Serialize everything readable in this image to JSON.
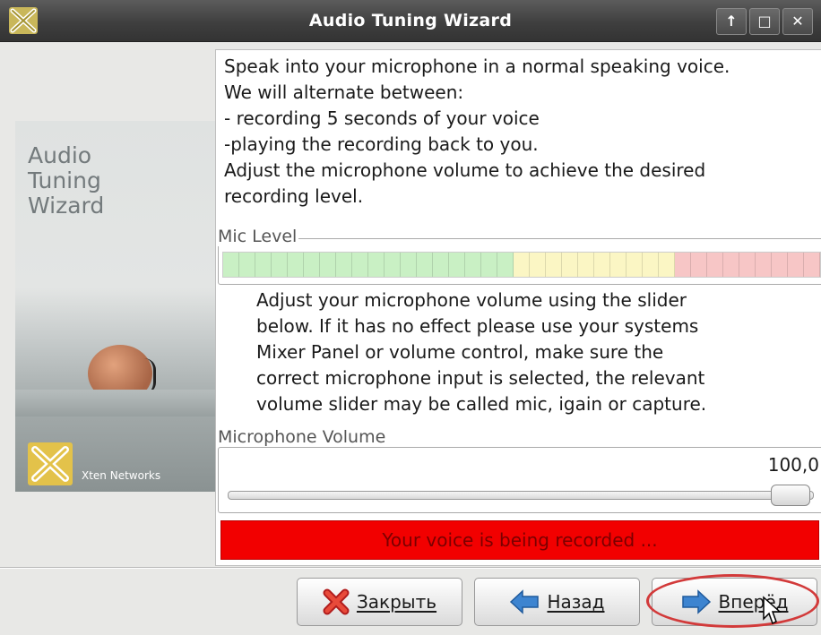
{
  "window": {
    "title": "Audio Tuning Wizard",
    "controls": [
      "↑",
      "□",
      "✕"
    ]
  },
  "banner": {
    "title_lines": [
      "Audio",
      "Tuning",
      "Wizard"
    ],
    "brand": "Xten Networks"
  },
  "intro": {
    "lines": [
      "Speak into your microphone in a normal speaking voice.",
      "We will alternate between:",
      "- recording 5 seconds of your voice",
      "-playing the recording back to you.",
      "Adjust the microphone volume to achieve the desired",
      "recording level."
    ]
  },
  "mic_level": {
    "label": "Mic Level",
    "segments_green": 18,
    "segments_yellow": 10,
    "segments_red": 9,
    "colors": {
      "green": "#c9f0c4",
      "yellow": "#fbf6c4",
      "red": "#f7c6c6"
    }
  },
  "help": {
    "lines": [
      "Adjust your microphone volume using the slider",
      "below. If it has no effect please use your systems",
      "Mixer Panel or volume control, make sure the",
      "correct microphone input is selected, the relevant",
      "volume slider may be called mic, igain or capture."
    ]
  },
  "mic_volume": {
    "label": "Microphone Volume",
    "value_text": "100,0",
    "level": 1.0
  },
  "status": {
    "text": "Your voice is being recorded ...",
    "color": "#f20000"
  },
  "buttons": {
    "close": "Закрыть",
    "back": "Назад",
    "next": "Вперёд"
  },
  "icons": {
    "close": "red-x-icon",
    "back": "blue-left-arrow-icon",
    "next": "blue-right-arrow-icon"
  }
}
